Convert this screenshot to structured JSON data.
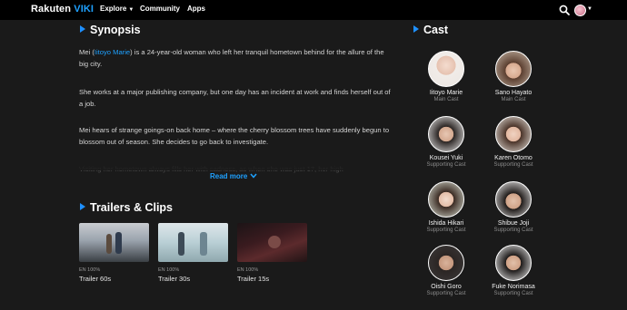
{
  "nav": {
    "logo_left": "Rakuten",
    "logo_right": "VIKI",
    "items": [
      {
        "label": "Explore",
        "has_caret": true
      },
      {
        "label": "Community",
        "has_caret": false
      },
      {
        "label": "Apps",
        "has_caret": false
      }
    ]
  },
  "synopsis": {
    "title": "Synopsis",
    "p1_pre": "Mei (",
    "p1_link": "Iitoyo Marie",
    "p1_post": ") is a 24-year-old woman who left her tranquil hometown behind for the allure of the big city.",
    "p2": "She works at a major publishing company, but one day has an incident at work and finds herself out of a job.",
    "p3": "Mei hears of strange goings-on back home – where the cherry blossom trees have suddenly begun to blossom out of season. She decides to go back to investigate.",
    "p4_faded": "Visiting her hometown always fills her with sadness, as when she was just 17, her high",
    "read_more": "Read more"
  },
  "trailers": {
    "title": "Trailers & Clips",
    "clips": [
      {
        "meta": "EN 100%",
        "title": "Trailer 60s"
      },
      {
        "meta": "EN 100%",
        "title": "Trailer 30s"
      },
      {
        "meta": "EN 100%",
        "title": "Trailer 15s"
      }
    ]
  },
  "cast": {
    "title": "Cast",
    "members": [
      {
        "name": "Iitoyo Marie",
        "role": "Main Cast"
      },
      {
        "name": "Sano Hayato",
        "role": "Main Cast"
      },
      {
        "name": "Kousei Yuki",
        "role": "Supporting Cast"
      },
      {
        "name": "Karen Otomo",
        "role": "Supporting Cast"
      },
      {
        "name": "Ishida Hikari",
        "role": "Supporting Cast"
      },
      {
        "name": "Shibue Joji",
        "role": "Supporting Cast"
      },
      {
        "name": "Oishi Goro",
        "role": "Supporting Cast"
      },
      {
        "name": "Fuke Norimasa",
        "role": "Supporting Cast"
      }
    ]
  },
  "colors": {
    "accent": "#1ea1ff",
    "background": "#1a1a1a",
    "nav": "#000000"
  }
}
